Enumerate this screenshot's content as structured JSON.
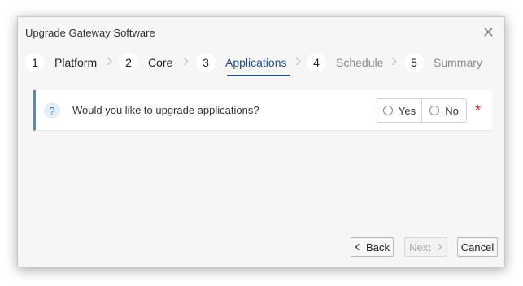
{
  "dialog": {
    "title": "Upgrade Gateway Software",
    "close_icon": "close-icon"
  },
  "steps": [
    {
      "number": "1",
      "label": "Platform",
      "state": "done"
    },
    {
      "number": "2",
      "label": "Core",
      "state": "done"
    },
    {
      "number": "3",
      "label": "Applications",
      "state": "active"
    },
    {
      "number": "4",
      "label": "Schedule",
      "state": "inactive"
    },
    {
      "number": "5",
      "label": "Summary",
      "state": "inactive"
    }
  ],
  "question": {
    "icon": "?",
    "text": "Would you like to upgrade applications?",
    "options": [
      "Yes",
      "No"
    ],
    "selected": null,
    "required_marker": "*"
  },
  "footer": {
    "back_label": "Back",
    "next_label": "Next",
    "next_disabled": true,
    "cancel_label": "Cancel"
  },
  "colors": {
    "accent": "#1f4f8f",
    "info_border": "#4a90c8",
    "required": "#dd3333"
  }
}
